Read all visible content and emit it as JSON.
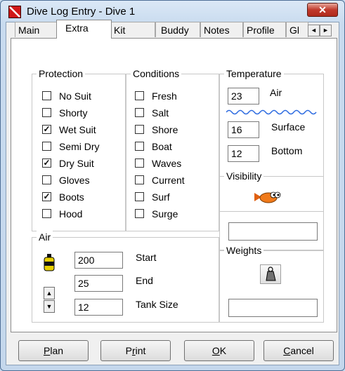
{
  "window": {
    "title": "Dive Log Entry - Dive 1",
    "close_label": "✕"
  },
  "tabs": [
    {
      "label": "Main",
      "active": false
    },
    {
      "label": "Extra",
      "active": true
    },
    {
      "label": "Kit",
      "active": false
    },
    {
      "label": "Buddy",
      "active": false
    },
    {
      "label": "Notes",
      "active": false
    },
    {
      "label": "Profile",
      "active": false
    },
    {
      "label": "Gl",
      "active": false
    }
  ],
  "tab_scroll": {
    "left": "◄",
    "right": "►"
  },
  "protection": {
    "title": "Protection",
    "items": [
      {
        "label": "No Suit",
        "checked": false
      },
      {
        "label": "Shorty",
        "checked": false
      },
      {
        "label": "Wet Suit",
        "checked": true
      },
      {
        "label": "Semi Dry",
        "checked": false
      },
      {
        "label": "Dry Suit",
        "checked": true
      },
      {
        "label": "Gloves",
        "checked": false
      },
      {
        "label": "Boots",
        "checked": true
      },
      {
        "label": "Hood",
        "checked": false
      }
    ]
  },
  "conditions": {
    "title": "Conditions",
    "items": [
      {
        "label": "Fresh",
        "checked": false
      },
      {
        "label": "Salt",
        "checked": false
      },
      {
        "label": "Shore",
        "checked": false
      },
      {
        "label": "Boat",
        "checked": false
      },
      {
        "label": "Waves",
        "checked": false
      },
      {
        "label": "Current",
        "checked": false
      },
      {
        "label": "Surf",
        "checked": false
      },
      {
        "label": "Surge",
        "checked": false
      }
    ]
  },
  "temperature": {
    "title": "Temperature",
    "air_value": "23",
    "air_label": "Air",
    "surface_value": "16",
    "surface_label": "Surface",
    "bottom_value": "12",
    "bottom_label": "Bottom"
  },
  "visibility": {
    "title": "Visibility",
    "value": ""
  },
  "air": {
    "title": "Air",
    "start_value": "200",
    "start_label": "Start",
    "end_value": "25",
    "end_label": "End",
    "tank_value": "12",
    "tank_label": "Tank Size",
    "spin_up": "▲",
    "spin_down": "▼"
  },
  "weights": {
    "title": "Weights",
    "value": ""
  },
  "buttons": {
    "plan_hotkey": "P",
    "plan_rest": "lan",
    "print_hotkey": "r",
    "print_pre": "P",
    "print_rest": "int",
    "ok_hotkey": "O",
    "ok_rest": "K",
    "cancel_hotkey": "C",
    "cancel_rest": "ancel"
  },
  "colors": {
    "close_button": "#c0392b",
    "app_icon": "#d01818",
    "water_wave": "#2d6be0",
    "fish": "#f07a1a",
    "tank": "#e8d000"
  }
}
